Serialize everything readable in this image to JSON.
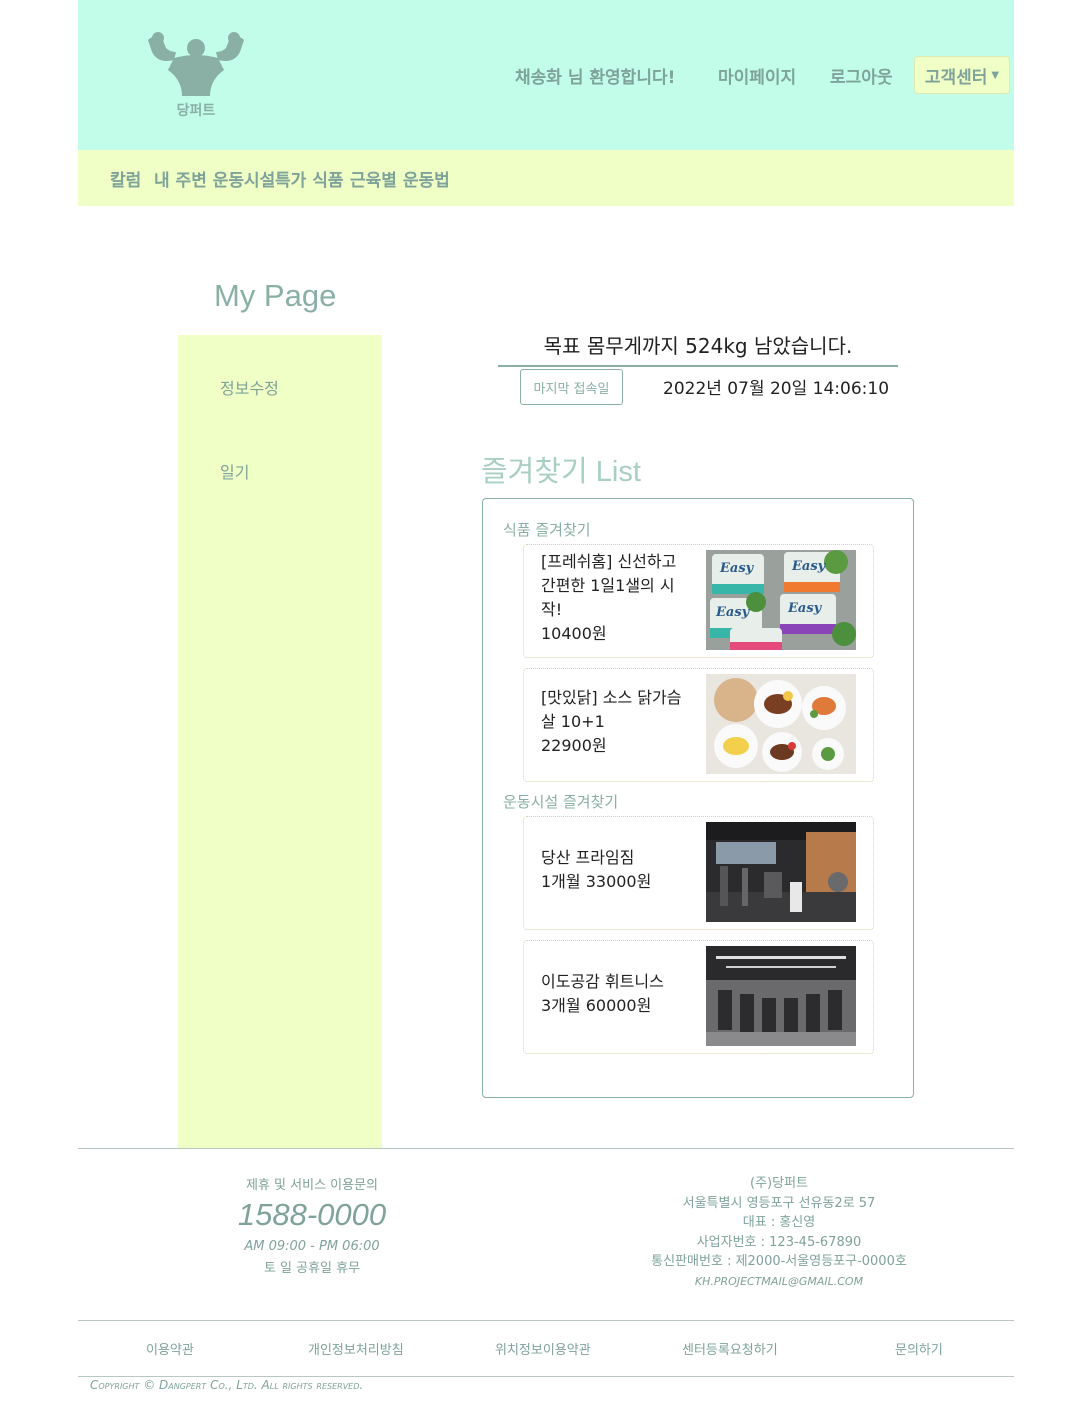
{
  "header": {
    "logo_text": "당퍼트",
    "welcome": "채송화 님 환영합니다!",
    "mypage": "마이페이지",
    "logout": "로그아웃",
    "customer_center": "고객센터"
  },
  "subnav": [
    "칼럼",
    "내 주변 운동시설",
    "특가 식품",
    "근육별 운동법"
  ],
  "page_title": "My Page",
  "sidebar": {
    "items": [
      "정보수정",
      "일기"
    ]
  },
  "goal": {
    "message": "목표 몸무게까지 524kg 남았습니다.",
    "last_login_label": "마지막 접속일",
    "last_login_time": "2022년 07월 20일 14:06:10"
  },
  "favorites": {
    "title": "즐겨찾기 List",
    "food_section": "식품 즐겨찾기",
    "gym_section": "운동시설 즐겨찾기",
    "food_items": [
      {
        "name": "[프레쉬홈] 신선하고 간편한 1일1샐의 시작!",
        "price": "10400원"
      },
      {
        "name": "[맛있닭] 소스 닭가슴살 10+1",
        "price": "22900원"
      }
    ],
    "gym_items": [
      {
        "name": "당산 프라임짐",
        "price": "1개월 33000원"
      },
      {
        "name": "이도공감 휘트니스",
        "price": "3개월 60000원"
      }
    ]
  },
  "footer": {
    "inquiry_label": "제휴 및 서비스 이용문의",
    "phone": "1588-0000",
    "hours": "AM 09:00 - PM 06:00",
    "holiday": "토 일 공휴일 휴무",
    "company": "(주)당퍼트",
    "address": "서울특별시 영등포구 선유동2로 57",
    "ceo": "대표 : 홍신영",
    "biz_no": "사업자번호 : 123-45-67890",
    "mail_order_no": "통신판매번호 : 제2000-서울영등포구-0000호",
    "email": "KH.PROJECTMAIL@GMAIL.COM",
    "links": [
      "이용약관",
      "개인정보처리방침",
      "위치정보이용약관",
      "센터등록요청하기",
      "문의하기"
    ],
    "copyright": "Copyright © Dangpert Co., Ltd. All rights reserved."
  },
  "colors": {
    "header_bg": "#c2fdea",
    "accent_bg": "#f0ffc6",
    "text_accent": "#7fa39a"
  }
}
